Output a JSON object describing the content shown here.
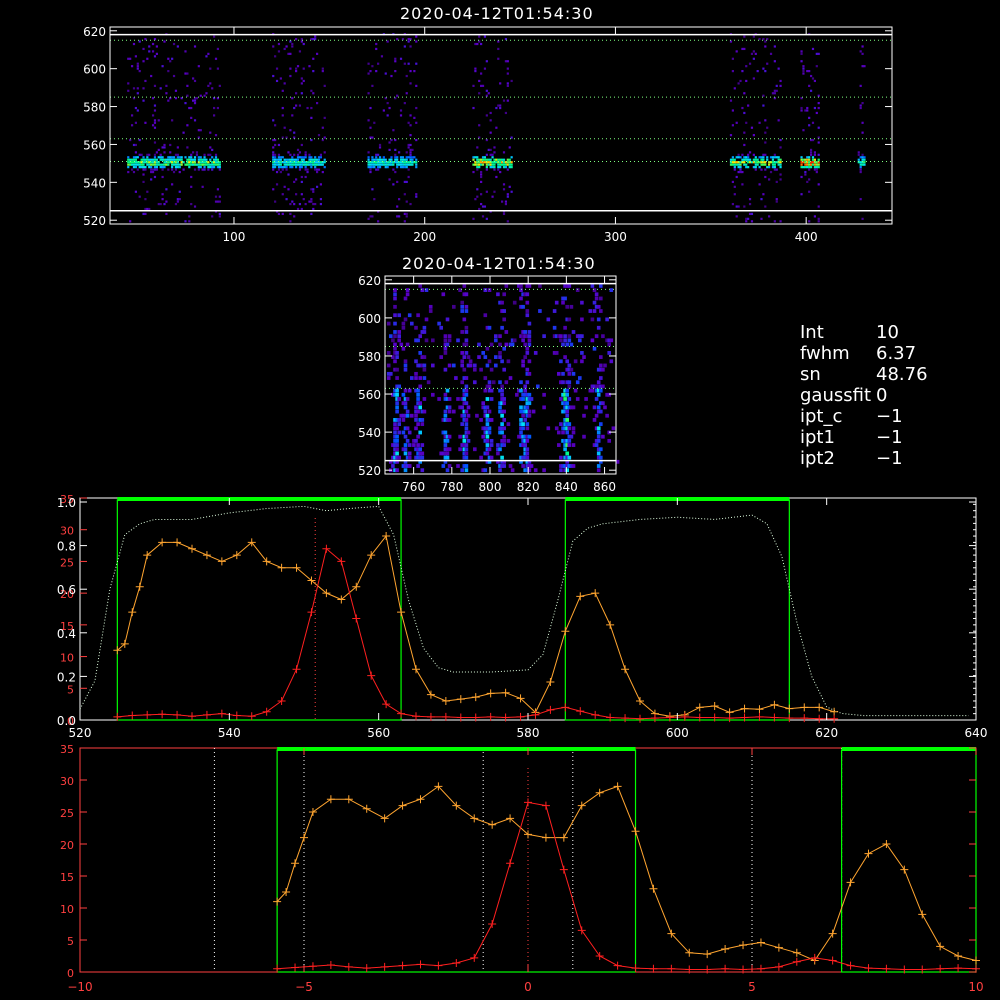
{
  "titles": {
    "top": "2020-04-12T01:54:30",
    "middle": "2020-04-12T01:54:30"
  },
  "info": [
    {
      "key": "Int",
      "value": "10"
    },
    {
      "key": "fwhm",
      "value": "6.37"
    },
    {
      "key": "sn",
      "value": "48.76"
    },
    {
      "key": "gaussfit",
      "value": "0"
    },
    {
      "key": "ipt_c",
      "value": "−1"
    },
    {
      "key": "ipt1",
      "value": "−1"
    },
    {
      "key": "ipt2",
      "value": "−1"
    }
  ],
  "colors": {
    "axis": "#ffffff",
    "red": "#ff2020",
    "orange": "#ffa530",
    "green": "#00ff00",
    "grid_dotted": "#80ff80"
  },
  "chart_data": [
    {
      "type": "heatmap",
      "title": "2020-04-12T01:54:30",
      "xlim": [
        35,
        445
      ],
      "ylim": [
        518,
        622
      ],
      "xticks": [
        "100",
        "200",
        "300",
        "400"
      ],
      "yticks": [
        "520",
        "540",
        "560",
        "580",
        "600",
        "620"
      ],
      "hlines_dotted": [
        615,
        585,
        563,
        551
      ],
      "hlines_solid": [
        618,
        525
      ],
      "bands": [
        {
          "x0": 44,
          "x1": 92,
          "peak": 0.75
        },
        {
          "x0": 120,
          "x1": 147,
          "peak": 0.55
        },
        {
          "x0": 170,
          "x1": 195,
          "peak": 0.55
        },
        {
          "x0": 225,
          "x1": 245,
          "peak": 0.9
        },
        {
          "x0": 360,
          "x1": 386,
          "peak": 0.8
        },
        {
          "x0": 397,
          "x1": 406,
          "peak": 1.0
        },
        {
          "x0": 427,
          "x1": 430,
          "peak": 0.6
        }
      ]
    },
    {
      "type": "heatmap",
      "title": "2020-04-12T01:54:30",
      "xlim": [
        745,
        866
      ],
      "ylim": [
        518,
        622
      ],
      "xticks": [
        "760",
        "780",
        "800",
        "820",
        "840",
        "860"
      ],
      "yticks": [
        "520",
        "540",
        "560",
        "580",
        "600",
        "620"
      ],
      "hlines_dotted": [
        615,
        585,
        563
      ],
      "hlines_solid": [
        618,
        525
      ],
      "streaks": [
        750,
        755,
        762,
        776,
        786,
        798,
        805,
        816,
        819,
        838,
        840,
        856
      ]
    },
    {
      "type": "line",
      "xlim": [
        520,
        640
      ],
      "xticks": [
        "520",
        "540",
        "560",
        "580",
        "600",
        "620",
        "640"
      ],
      "yticks_left_red": [
        "0",
        "5",
        "10",
        "15",
        "20",
        "25",
        "30",
        "35"
      ],
      "yticks_left_white": [
        "0.0",
        "0.2",
        "0.4",
        "0.6",
        "0.8",
        "1.0"
      ],
      "series": [
        {
          "color": "red",
          "x": [
            525,
            527,
            529,
            531,
            533,
            535,
            537,
            539,
            541,
            543,
            545,
            547,
            549,
            551,
            553,
            555,
            557,
            559,
            561,
            563,
            565,
            567,
            569,
            571,
            573,
            575,
            577,
            579,
            581,
            583,
            585,
            587,
            589,
            591,
            593,
            595,
            597,
            599,
            601,
            603,
            605,
            607,
            609,
            611,
            613,
            615,
            617,
            619,
            621
          ],
          "y": [
            0.5,
            0.7,
            0.8,
            0.9,
            0.8,
            0.6,
            0.8,
            1.0,
            0.7,
            0.6,
            1.3,
            3.0,
            8.0,
            17.0,
            27.0,
            25.0,
            16.0,
            7.0,
            2.5,
            1.0,
            0.6,
            0.5,
            0.5,
            0.4,
            0.4,
            0.5,
            0.4,
            0.5,
            0.8,
            1.6,
            2.0,
            1.4,
            0.8,
            0.4,
            0.3,
            0.2,
            0.3,
            0.4,
            0.5,
            0.4,
            0.4,
            0.3,
            0.4,
            0.5,
            0.4,
            0.3,
            0.3,
            0.2,
            0.2
          ]
        },
        {
          "color": "orange",
          "x": [
            525,
            526,
            527,
            528,
            529,
            531,
            533,
            535,
            537,
            539,
            541,
            543,
            545,
            547,
            549,
            551,
            553,
            555,
            557,
            559,
            561,
            563,
            565,
            567,
            569,
            571,
            573,
            575,
            577,
            579,
            581,
            583,
            585,
            587,
            589,
            591,
            593,
            595,
            597,
            599,
            601,
            603,
            605,
            607,
            609,
            611,
            613,
            615,
            617,
            619,
            621
          ],
          "y": [
            11,
            12,
            17,
            21,
            26,
            28,
            28,
            27,
            26,
            25,
            26,
            28,
            25,
            24,
            24,
            22,
            20,
            19,
            21,
            26,
            29,
            17,
            8,
            4,
            3,
            3.3,
            3.6,
            4.2,
            4.3,
            3.4,
            1.2,
            6,
            14,
            19.5,
            20,
            15,
            8,
            3,
            1,
            0.6,
            0.8,
            2,
            2.2,
            1.2,
            1.8,
            1.7,
            2.4,
            1.8,
            2.0,
            2.0,
            1.3
          ]
        },
        {
          "color": "white_dotted",
          "x": [
            520,
            522,
            524,
            526,
            528,
            530,
            535,
            540,
            545,
            550,
            553,
            556,
            560,
            562,
            564,
            566,
            568,
            570,
            575,
            580,
            582,
            584,
            586,
            588,
            590,
            595,
            600,
            605,
            610,
            612,
            614,
            616,
            618,
            620,
            622,
            625,
            630,
            635,
            639
          ],
          "y": [
            0.05,
            0.18,
            0.6,
            0.85,
            0.9,
            0.92,
            0.92,
            0.95,
            0.97,
            0.98,
            0.96,
            0.97,
            0.98,
            0.85,
            0.55,
            0.33,
            0.24,
            0.22,
            0.22,
            0.23,
            0.3,
            0.55,
            0.82,
            0.88,
            0.9,
            0.92,
            0.93,
            0.92,
            0.94,
            0.9,
            0.75,
            0.45,
            0.2,
            0.06,
            0.03,
            0.02,
            0.02,
            0.02,
            0.02
          ]
        }
      ],
      "green_boxes": [
        [
          525,
          563
        ],
        [
          585,
          615
        ]
      ],
      "vline_x": 551.5
    },
    {
      "type": "line",
      "xlim": [
        -10,
        10
      ],
      "ylim": [
        0,
        35
      ],
      "xticks": [
        "−10",
        "−5",
        "0",
        "5",
        "10"
      ],
      "yticks": [
        "0",
        "5",
        "10",
        "15",
        "20",
        "25",
        "30",
        "35"
      ],
      "series": [
        {
          "color": "red",
          "x": [
            -5.6,
            -5.2,
            -4.8,
            -4.4,
            -4.0,
            -3.6,
            -3.2,
            -2.8,
            -2.4,
            -2.0,
            -1.6,
            -1.2,
            -0.8,
            -0.4,
            0.0,
            0.4,
            0.8,
            1.2,
            1.6,
            2.0,
            2.4,
            2.8,
            3.2,
            3.6,
            4.0,
            4.4,
            4.8,
            5.2,
            5.6,
            6.0,
            6.4,
            6.8,
            7.2,
            7.6,
            8.0,
            8.4,
            8.8,
            9.2,
            9.6,
            10.0
          ],
          "y": [
            0.5,
            0.7,
            0.9,
            1.1,
            0.8,
            0.6,
            0.8,
            1.0,
            1.2,
            1.0,
            1.4,
            2.2,
            7.5,
            17,
            26.5,
            26,
            16,
            6.5,
            2.5,
            1.0,
            0.6,
            0.5,
            0.5,
            0.4,
            0.4,
            0.5,
            0.4,
            0.5,
            0.8,
            1.6,
            2.2,
            1.8,
            1.0,
            0.6,
            0.5,
            0.4,
            0.4,
            0.5,
            0.6,
            0.5
          ]
        },
        {
          "color": "orange",
          "x": [
            -5.6,
            -5.4,
            -5.2,
            -5.0,
            -4.8,
            -4.4,
            -4.0,
            -3.6,
            -3.2,
            -2.8,
            -2.4,
            -2.0,
            -1.6,
            -1.2,
            -0.8,
            -0.4,
            0.0,
            0.4,
            0.8,
            1.2,
            1.6,
            2.0,
            2.4,
            2.8,
            3.2,
            3.6,
            4.0,
            4.4,
            4.8,
            5.2,
            5.6,
            6.0,
            6.4,
            6.8,
            7.2,
            7.6,
            8.0,
            8.4,
            8.8,
            9.2,
            9.6,
            10.0
          ],
          "y": [
            11,
            12.5,
            17,
            21,
            25,
            27,
            27,
            25.5,
            24,
            26,
            27,
            29,
            26,
            24,
            23,
            24,
            21.5,
            21,
            21,
            26,
            28,
            29,
            22,
            13,
            6,
            3,
            2.8,
            3.6,
            4.2,
            4.6,
            3.8,
            3.0,
            1.8,
            6,
            14,
            18.5,
            20,
            16,
            9,
            4,
            2.5,
            1.8
          ]
        }
      ],
      "green_boxes": [
        [
          -5.6,
          2.4
        ],
        [
          7.0,
          10.0
        ]
      ],
      "vlines_dotted_white": [
        -7,
        -5,
        -1,
        1,
        5,
        7
      ],
      "vline_red": 0
    }
  ]
}
